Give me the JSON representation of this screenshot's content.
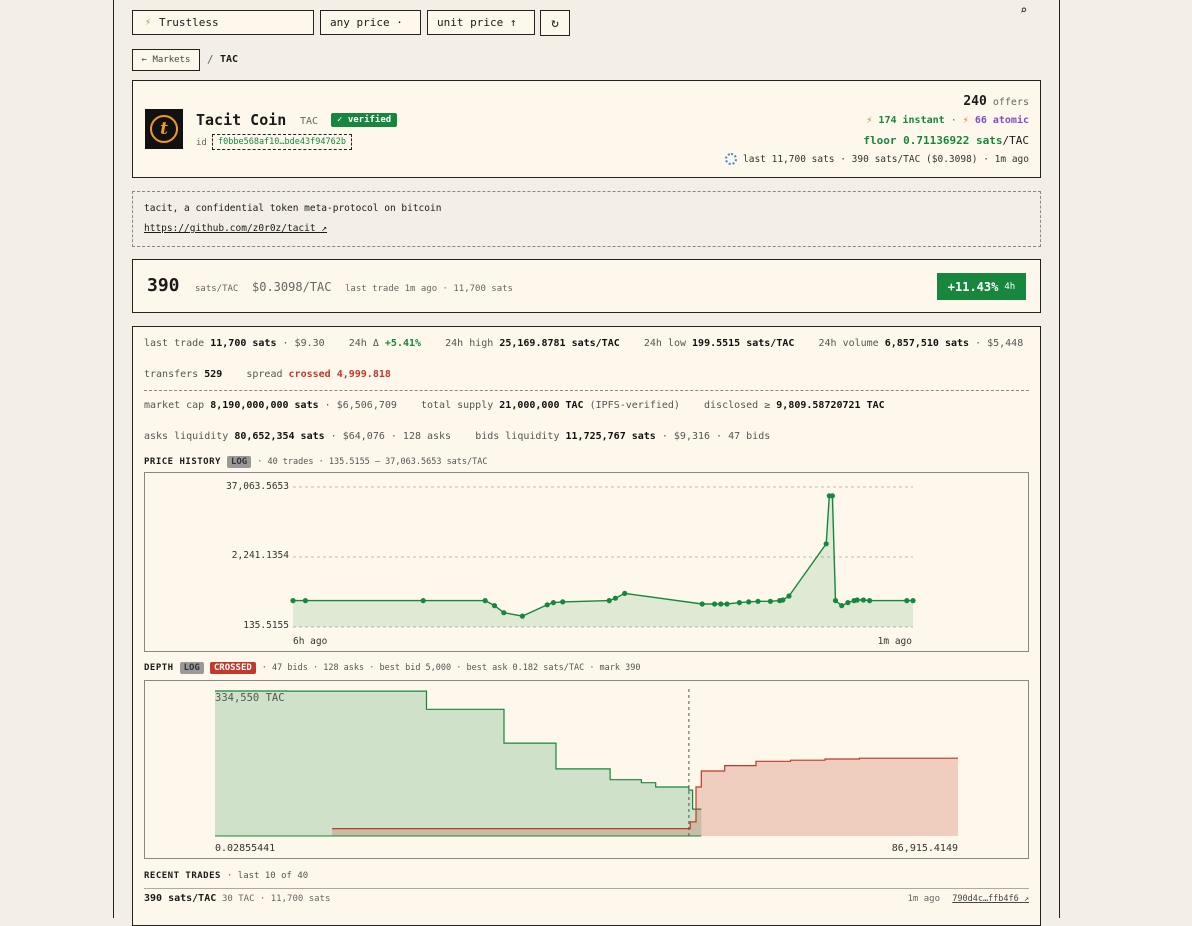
{
  "filters": {
    "search_value": "Trustless",
    "price_select": "any price ·",
    "sort_select": "unit price ↑",
    "refresh_glyph": "↻",
    "search_glyph": "⌕",
    "bolt_glyph": "⚡"
  },
  "breadcrumb": {
    "back_label": "← Markets",
    "separator": "/",
    "current": "TAC"
  },
  "token": {
    "logo_letter": "t",
    "name": "Tacit Coin",
    "ticker": "TAC",
    "verified_label": "✓ verified",
    "id_label": "id",
    "id_value": "f0bbe568af10…bde43f94762b",
    "offers_count": "240",
    "offers_label": "offers",
    "instant_label": "174 instant",
    "dot": "·",
    "atomic_label": "66 atomic",
    "floor_label": "floor 0.71136922 sats",
    "floor_unit": "/TAC",
    "last_line": "last 11,700 sats · 390 sats/TAC ($0.3098) · 1m ago"
  },
  "description": {
    "text": "tacit, a confidential token meta-protocol on bitcoin",
    "link": "https://github.com/z0r0z/tacit ↗"
  },
  "price": {
    "value": "390",
    "unit": "sats/TAC",
    "usd": "$0.3098/TAC",
    "last_trade": "last trade 1m ago · 11,700 sats",
    "change": "+11.43%",
    "change_period": "4h"
  },
  "stats": {
    "row1": [
      {
        "label": "last trade",
        "value": "11,700 sats",
        "extra": "· $9.30"
      },
      {
        "label": "24h Δ",
        "value": "+5.41%",
        "extra": ""
      },
      {
        "label": "24h high",
        "value": "25,169.8781 sats/TAC",
        "extra": ""
      },
      {
        "label": "24h low",
        "value": "199.5515 sats/TAC",
        "extra": ""
      },
      {
        "label": "24h volume",
        "value": "6,857,510 sats",
        "extra": "· $5,448"
      }
    ],
    "transfers_label": "transfers",
    "transfers_value": "529",
    "spread_label": "spread",
    "spread_value": "crossed 4,999.818",
    "row3": [
      {
        "label": "market cap",
        "value": "8,190,000,000 sats",
        "extra": "· $6,506,709"
      },
      {
        "label": "total supply",
        "value": "21,000,000 TAC",
        "extra": "(IPFS-verified)"
      },
      {
        "label": "disclosed ≥",
        "value": "9,809.58720721 TAC",
        "extra": ""
      }
    ],
    "row4": [
      {
        "label": "asks liquidity",
        "value": "80,652,354 sats",
        "extra": "· $64,076 · 128 asks"
      },
      {
        "label": "bids liquidity",
        "value": "11,725,767 sats",
        "extra": "· $9,316 · 47 bids"
      }
    ]
  },
  "price_history": {
    "title": "PRICE HISTORY",
    "log_tag": "LOG",
    "summary": "· 40 trades · 135.5155 – 37,063.5653 sats/TAC",
    "y_top": "37,063.5653",
    "y_mid": "2,241.1354",
    "y_bottom": "135.5155",
    "x_start": "6h ago",
    "x_end": "1m ago"
  },
  "depth": {
    "title": "DEPTH",
    "log_tag": "LOG",
    "crossed_tag": "CROSSED",
    "summary": "· 47 bids · 128 asks · best bid 5,000 · best ask 0.182 sats/TAC · mark 390",
    "y_label": "334,550 TAC",
    "x_start": "0.02855441",
    "x_end": "86,915.4149"
  },
  "recent_trades": {
    "title": "RECENT TRADES",
    "summary": "· last 10 of 40",
    "rows": [
      {
        "price": "390 sats/TAC",
        "detail": "30 TAC · 11,700 sats",
        "time": "1m ago",
        "tx": "790d4c…ffb4f6 ↗"
      }
    ]
  },
  "colors": {
    "green": "#17873d",
    "red": "#c0392b",
    "orange": "#e8742a",
    "purple": "#7b4fc9",
    "panel": "#fdf8eb",
    "page": "#f3efe6"
  },
  "chart_data": [
    {
      "type": "line",
      "title": "PRICE HISTORY",
      "y_scale": "log",
      "ylim": [
        135.5155,
        37063.5653
      ],
      "y_ticks": [
        135.5155,
        2241.1354,
        37063.5653
      ],
      "x_ticks": [
        "6h ago",
        "1m ago"
      ],
      "grid": true,
      "series": [
        {
          "values": [
            [
              0,
              390
            ],
            [
              0.02,
              390
            ],
            [
              0.21,
              390
            ],
            [
              0.31,
              390
            ],
            [
              0.325,
              320
            ],
            [
              0.34,
              240
            ],
            [
              0.37,
              210
            ],
            [
              0.41,
              330
            ],
            [
              0.42,
              360
            ],
            [
              0.435,
              370
            ],
            [
              0.51,
              390
            ],
            [
              0.52,
              430
            ],
            [
              0.535,
              520
            ],
            [
              0.66,
              340
            ],
            [
              0.68,
              340
            ],
            [
              0.69,
              340
            ],
            [
              0.7,
              340
            ],
            [
              0.72,
              360
            ],
            [
              0.735,
              370
            ],
            [
              0.75,
              380
            ],
            [
              0.77,
              380
            ],
            [
              0.785,
              390
            ],
            [
              0.79,
              400
            ],
            [
              0.8,
              470
            ],
            [
              0.86,
              3800
            ],
            [
              0.865,
              26000
            ],
            [
              0.87,
              26000
            ],
            [
              0.875,
              390
            ],
            [
              0.885,
              320
            ],
            [
              0.895,
              360
            ],
            [
              0.905,
              390
            ],
            [
              0.91,
              400
            ],
            [
              0.92,
              400
            ],
            [
              0.93,
              390
            ],
            [
              0.99,
              390
            ],
            [
              1.0,
              390
            ]
          ]
        }
      ]
    },
    {
      "type": "area",
      "title": "DEPTH",
      "x_scale": "log",
      "y_scale": "log",
      "xlim": [
        0.02855441,
        86915.4149
      ],
      "y_label": "334,550 TAC",
      "mark": 390,
      "series": [
        {
          "name": "bids",
          "color": "#17873d",
          "values": [
            [
              0.02855441,
              334550
            ],
            [
              0.06,
              334550
            ],
            [
              0.12,
              330000
            ],
            [
              0.5,
              330000
            ],
            [
              1.2,
              330000
            ],
            [
              2.0,
              60000
            ],
            [
              9.0,
              60000
            ],
            [
              9.5,
              2500
            ],
            [
              25,
              2500
            ],
            [
              27,
              220
            ],
            [
              60,
              220
            ],
            [
              80,
              80
            ],
            [
              150,
              60
            ],
            [
              200,
              40
            ],
            [
              390,
              30
            ],
            [
              420,
              5
            ],
            [
              500,
              5
            ]
          ]
        },
        {
          "name": "asks",
          "color": "#c0392b",
          "values": [
            [
              0.3,
              0.8
            ],
            [
              380,
              0.8
            ],
            [
              400,
              1.5
            ],
            [
              450,
              40
            ],
            [
              500,
              180
            ],
            [
              800,
              300
            ],
            [
              1500,
              450
            ],
            [
              3000,
              500
            ],
            [
              6000,
              560
            ],
            [
              12000,
              600
            ],
            [
              86915.4149,
              600
            ]
          ]
        }
      ]
    }
  ]
}
